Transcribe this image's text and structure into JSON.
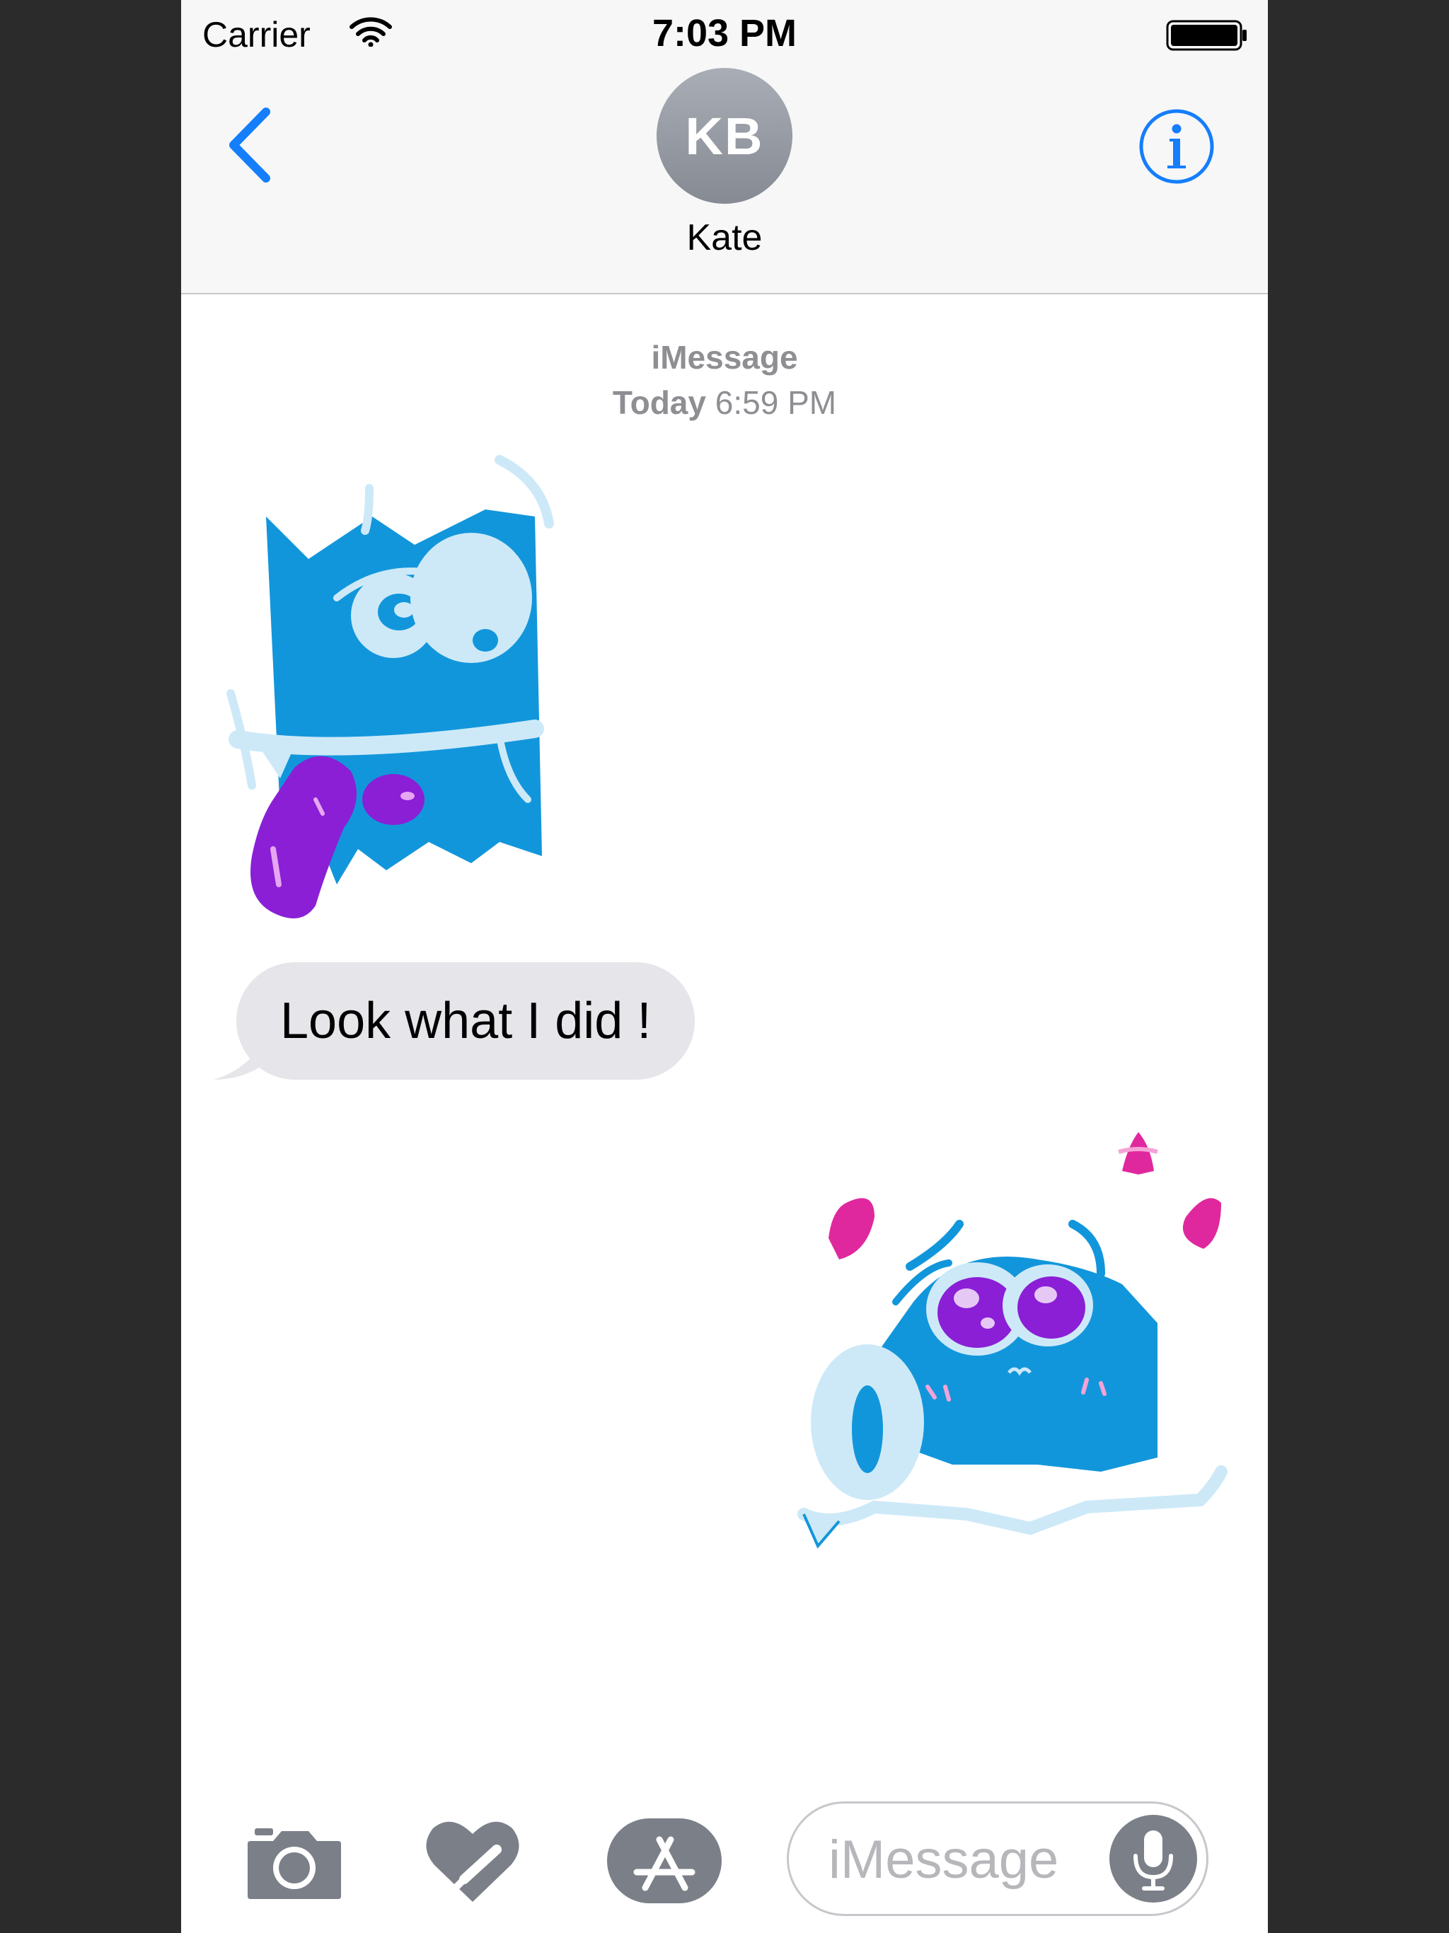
{
  "status_bar": {
    "carrier": "Carrier",
    "time": "7:03 PM"
  },
  "header": {
    "avatar_initials": "KB",
    "contact_name": "Kate",
    "back_icon": "chevron-left-icon",
    "info_icon": "info-circle-icon"
  },
  "conversation": {
    "service": "iMessage",
    "date_label": "Today",
    "time_label": "6:59 PM",
    "messages": [
      {
        "type": "sticker",
        "direction": "incoming",
        "description_icon": "blue-monster-sticker"
      },
      {
        "type": "text",
        "direction": "incoming",
        "text": "Look what I did !"
      },
      {
        "type": "sticker",
        "direction": "outgoing",
        "description_icon": "blue-roll-monster-sticker"
      }
    ]
  },
  "toolbar": {
    "camera_icon": "camera-icon",
    "digital_touch_icon": "digital-touch-heart-icon",
    "app_store_icon": "app-store-icon",
    "input_placeholder": "iMessage",
    "mic_icon": "microphone-icon"
  },
  "colors": {
    "accent": "#147efb",
    "bubble_incoming": "#e5e5ea",
    "sticker_blue": "#1296db",
    "sticker_purple": "#8a1fd6",
    "sticker_pink": "#e0289e"
  }
}
